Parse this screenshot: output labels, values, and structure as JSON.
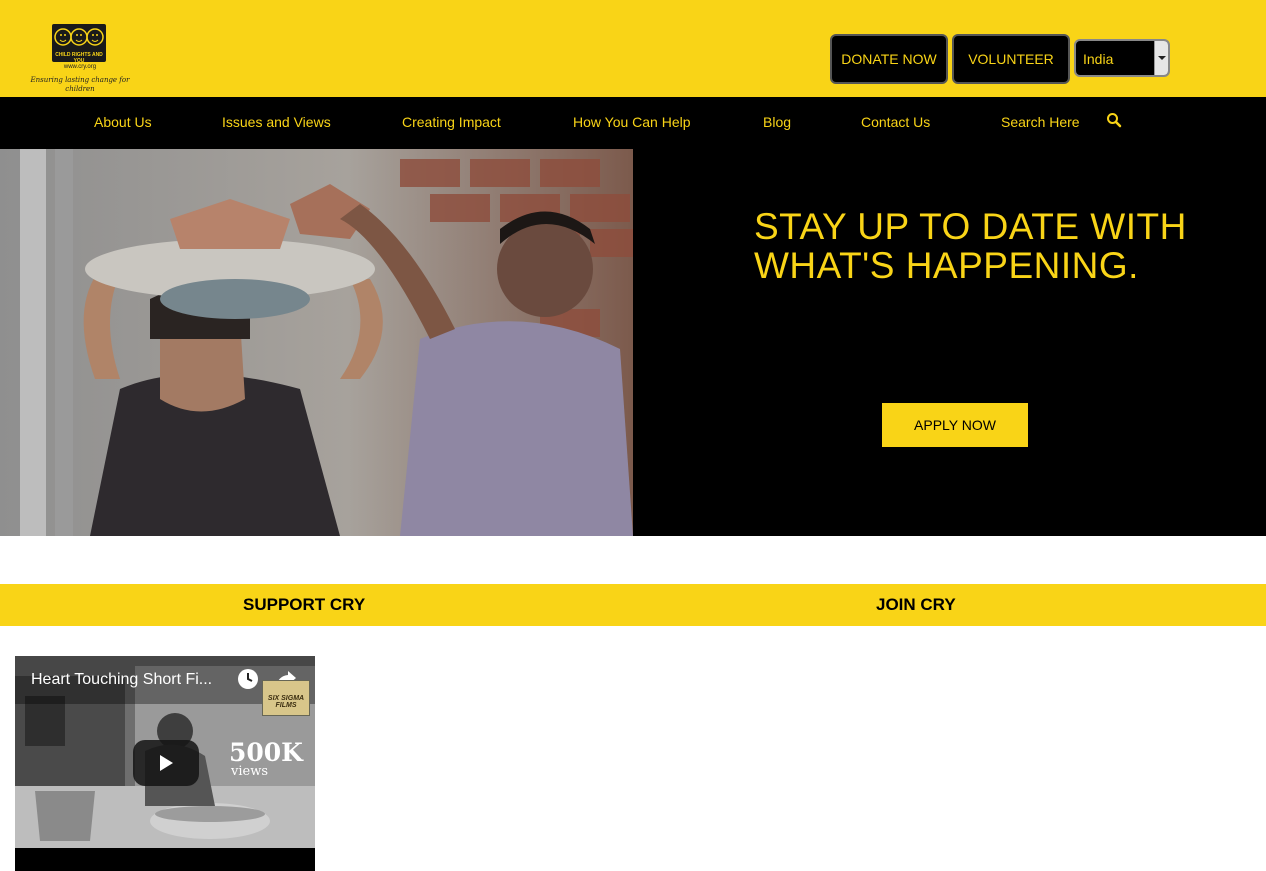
{
  "header": {
    "logo": {
      "name": "CRY",
      "subtitle": "CHILD RIGHTS AND YOU",
      "url": "www.cry.org",
      "tagline": "Ensuring lasting change for children"
    },
    "donate_label": "DONATE NOW",
    "volunteer_label": "VOLUNTEER",
    "country_selected": "India"
  },
  "nav": {
    "items": [
      {
        "label": "About Us"
      },
      {
        "label": "Issues and Views"
      },
      {
        "label": "Creating Impact"
      },
      {
        "label": "How You Can Help"
      },
      {
        "label": "Blog"
      },
      {
        "label": "Contact Us"
      },
      {
        "label": "Search Here"
      }
    ],
    "search_icon": "search-icon"
  },
  "hero": {
    "title": "STAY UP TO DATE WITH WHAT'S HAPPENING.",
    "apply_label": "APPLY NOW",
    "image": "children-carrying-bricks-photo"
  },
  "bar": {
    "support_label": "SUPPORT CRY",
    "join_label": "JOIN CRY"
  },
  "video": {
    "title": "Heart Touching Short Fi...",
    "views_number": "500K",
    "views_label": "views",
    "channel_badge": "SIX SIGMA FILMS",
    "play_icon": "play-icon",
    "watch_later_icon": "clock-icon",
    "share_icon": "share-icon"
  },
  "colors": {
    "brand_yellow": "#f9d417",
    "black": "#000000",
    "white": "#ffffff"
  }
}
